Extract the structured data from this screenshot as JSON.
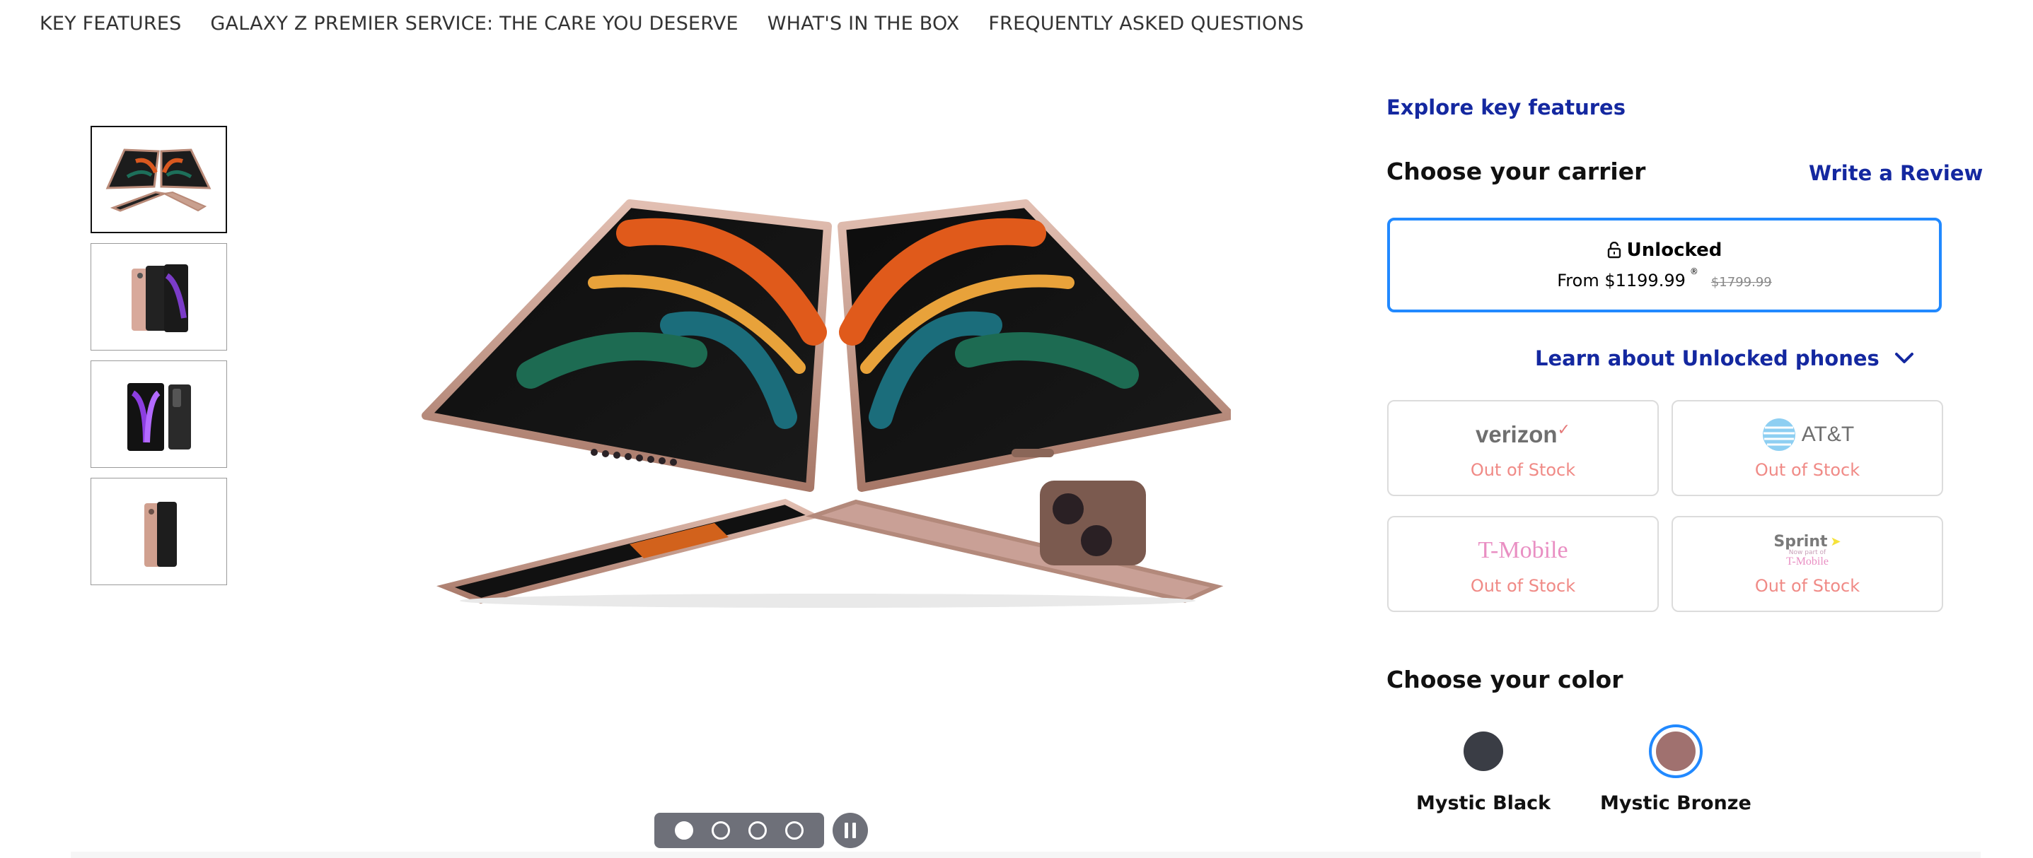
{
  "nav": {
    "items": [
      {
        "label": "KEY FEATURES"
      },
      {
        "label": "GALAXY Z PREMIER SERVICE: THE CARE YOU DESERVE"
      },
      {
        "label": "WHAT'S IN THE BOX"
      },
      {
        "label": "FREQUENTLY ASKED QUESTIONS"
      }
    ]
  },
  "gallery": {
    "thumbnails": 4,
    "active_index": 0,
    "carousel_dots": 4,
    "active_dot": 0
  },
  "right": {
    "explore_link": "Explore key features",
    "carrier_title": "Choose your carrier",
    "write_review": "Write a Review",
    "unlocked": {
      "name": "Unlocked",
      "price": "From $1199.99",
      "price_marker": "®",
      "old_price": "$1799.99"
    },
    "learn_link": "Learn about Unlocked phones",
    "carriers": [
      {
        "name": "verizon",
        "status": "Out of Stock"
      },
      {
        "name": "AT&T",
        "status": "Out of Stock"
      },
      {
        "name": "T-Mobile",
        "status": "Out of Stock"
      },
      {
        "name": "Sprint",
        "sub": "Now part of",
        "sub2": "T-Mobile",
        "status": "Out of Stock"
      }
    ],
    "color_title": "Choose your color",
    "colors": [
      {
        "name": "Mystic Black",
        "hex": "#3a3d45",
        "selected": false
      },
      {
        "name": "Mystic Bronze",
        "hex": "#a0716f",
        "selected": true
      }
    ]
  },
  "colors": {
    "accent_blue": "#1428a0",
    "selection_blue": "#2189ff",
    "out_of_stock": "#f08a86"
  }
}
